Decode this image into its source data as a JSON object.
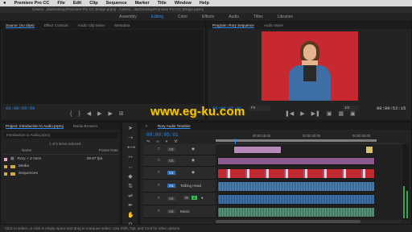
{
  "menubar": {
    "app_name": "Premiere Pro CC",
    "items": [
      "File",
      "Edit",
      "Clip",
      "Sequence",
      "Marker",
      "Title",
      "Window",
      "Help"
    ]
  },
  "titlebar": {
    "path": "/Users/...dia/Desktop/Premiere Pro CC Bridge.prproj - /Users/...dia/Desktop/Premiere Pro CC Bridge.prproj"
  },
  "workspaces": {
    "items": [
      "Assembly",
      "Editing",
      "Color",
      "Effects",
      "Audio",
      "Titles",
      "Libraries"
    ],
    "active": "Editing"
  },
  "source_panel": {
    "tabs": [
      "Source: (no clips)",
      "Effect Controls",
      "Audio Clip Mixer",
      "Metadata"
    ],
    "timecode": "00:00:00:00"
  },
  "program_panel": {
    "tabs": [
      "Program: Rory Sequence",
      "Audio Mixer"
    ],
    "timecode_left": "00:00:05:01",
    "fit_label": "Fit",
    "zoom_label": "1/2",
    "timecode_right": "00:00:52:15"
  },
  "watermark": {
    "text": "www.eg-ku.com"
  },
  "project_panel": {
    "tabs": [
      "Project: Introduction to Audio.prproj",
      "Media Browser"
    ],
    "search_placeholder": "Introduction to Audio.prproj",
    "count": "1 of 5 items selected",
    "col_name": "Name",
    "col_rate": "Frame Rate",
    "items": [
      {
        "name": "Rory + 2 mics",
        "rate": "29.97 fps",
        "color": "#e8a8d0",
        "kind": "sequence"
      },
      {
        "name": "Media",
        "rate": "",
        "color": "#cfa84a",
        "kind": "folder"
      },
      {
        "name": "Sequences",
        "rate": "",
        "color": "#cfa84a",
        "kind": "folder"
      }
    ]
  },
  "timeline": {
    "tab": "Rory Audio Timeline",
    "timecode": "00:00:05:01",
    "ruler": [
      "00:00:15:00",
      "00:00:30:00",
      "00:00:45:00"
    ],
    "tracks": [
      {
        "id": "V3",
        "label": "V3"
      },
      {
        "id": "V2",
        "label": "V2"
      },
      {
        "id": "V1",
        "label": "V1"
      },
      {
        "id": "A1",
        "label": "A1",
        "name": "Talking Head"
      },
      {
        "id": "A2",
        "label": "A2"
      },
      {
        "id": "A3",
        "label": "A3",
        "name": "Music"
      }
    ]
  },
  "status": {
    "text": "Click to select, or click in empty space and drag to marquee select. Use Shift, Opt, and Cmd for other options."
  }
}
